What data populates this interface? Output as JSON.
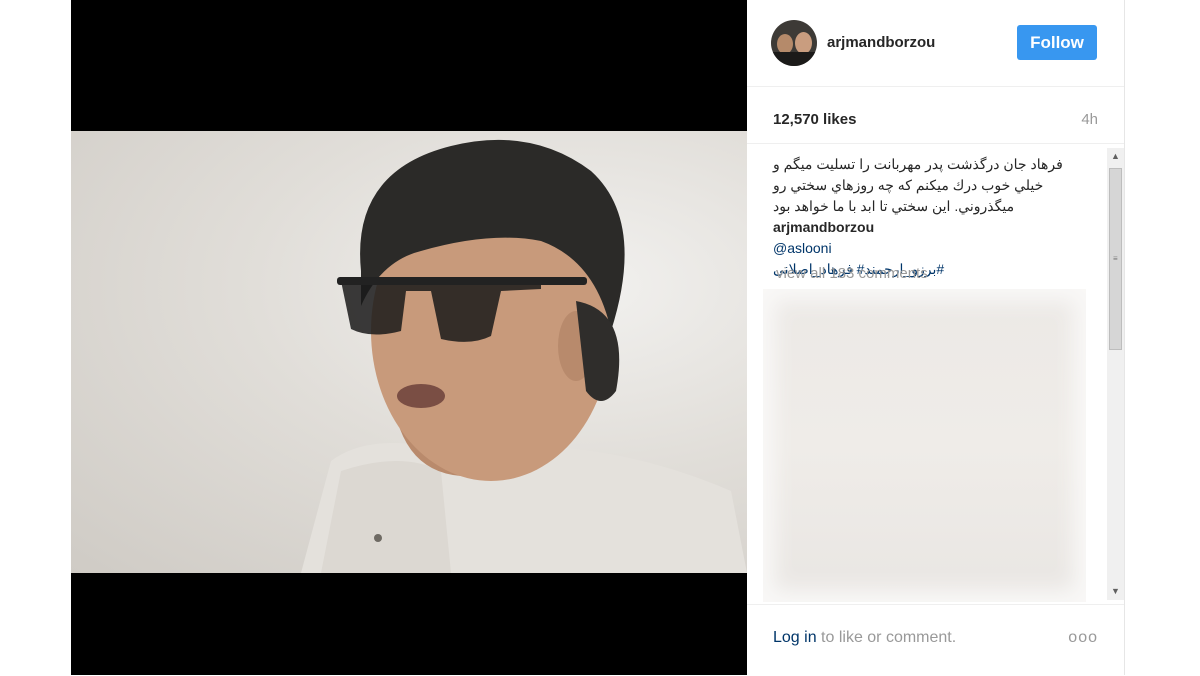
{
  "post": {
    "image_alt": "photo of man with glasses"
  },
  "header": {
    "username": "arjmandborzou",
    "follow_label": "Follow"
  },
  "stats": {
    "likes": "12,570 likes",
    "time": "4h"
  },
  "caption": {
    "user": "arjmandborzou",
    "text": "فرهاد جان درگذشت پدر مهربانت را تسليت ميگم و خيلي خوب درك ميكنم كه چه روزهاي سختي رو ميگذروني. اين سختي تا ابد با ما خواهد بود",
    "mention": "@aslooni",
    "hashtags": "#برزو_ارجمند# فرهاد_اصلانی"
  },
  "comments": {
    "view_all": "view all 183 comments"
  },
  "footer": {
    "login": "Log in",
    "login_suffix": " to like or comment.",
    "more": "ooo"
  },
  "scrollbar": {
    "up": "▲",
    "down": "▼",
    "grip": "≡"
  },
  "colors": {
    "accent": "#3897f0",
    "link": "#003569"
  }
}
